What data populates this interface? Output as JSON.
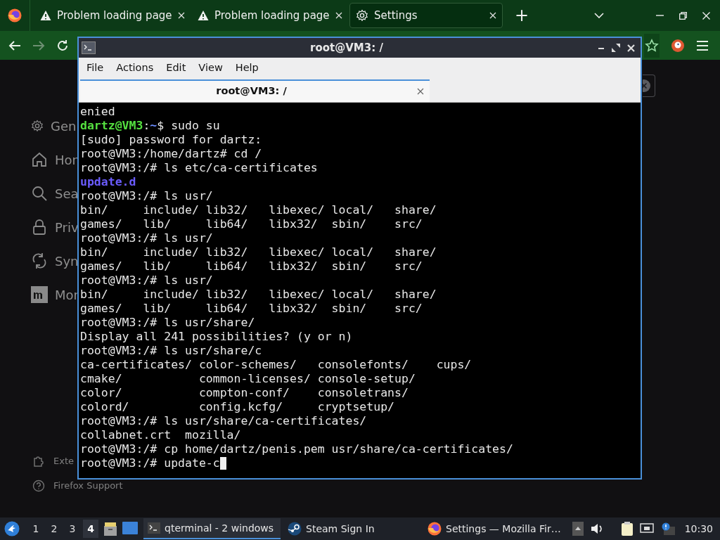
{
  "browser": {
    "tabs": [
      {
        "title": "Problem loading page",
        "kind": "warning",
        "selected": false
      },
      {
        "title": "Problem loading page",
        "kind": "warning",
        "selected": false
      },
      {
        "title": "Settings",
        "kind": "gear",
        "selected": true
      }
    ],
    "new_tab": "+",
    "sidebar": {
      "items": [
        {
          "label": "Gen",
          "kind": "gear"
        },
        {
          "label": "Hon",
          "kind": "home"
        },
        {
          "label": "Sea",
          "kind": "search"
        },
        {
          "label": "Priv",
          "kind": "lock"
        },
        {
          "label": "Syn",
          "kind": "sync"
        },
        {
          "label": "Mor",
          "kind": "m"
        }
      ],
      "footer": [
        {
          "label": "Exte",
          "kind": "puzzle"
        },
        {
          "label": "Firefox Support",
          "kind": "help"
        }
      ]
    }
  },
  "terminal": {
    "title": "root@VM3: /",
    "menu": [
      "File",
      "Actions",
      "Edit",
      "View",
      "Help"
    ],
    "tabs": [
      {
        "title": "root@VM3: /",
        "selected": true
      }
    ],
    "lines": [
      [
        {
          "t": "enied",
          "kind": "plain"
        }
      ],
      [
        {
          "t": "dartz@VM3",
          "kind": "user"
        },
        {
          "t": ":",
          "kind": "plain"
        },
        {
          "t": "~",
          "kind": "path"
        },
        {
          "t": "$ sudo su",
          "kind": "plain"
        }
      ],
      [
        {
          "t": "[sudo] password for dartz:",
          "kind": "plain"
        }
      ],
      [
        {
          "t": "root@VM3:/home/dartz# cd /",
          "kind": "plain"
        }
      ],
      [
        {
          "t": "root@VM3:/# ls etc/ca-certificates",
          "kind": "plain"
        }
      ],
      [
        {
          "t": "update.d",
          "kind": "dir"
        }
      ],
      [
        {
          "t": "root@VM3:/# ls usr/",
          "kind": "plain"
        }
      ],
      [
        {
          "t": "bin/     include/ lib32/   libexec/ local/   share/",
          "kind": "plain"
        }
      ],
      [
        {
          "t": "games/   lib/     lib64/   libx32/  sbin/    src/",
          "kind": "plain"
        }
      ],
      [
        {
          "t": "root@VM3:/# ls usr/",
          "kind": "plain"
        }
      ],
      [
        {
          "t": "bin/     include/ lib32/   libexec/ local/   share/",
          "kind": "plain"
        }
      ],
      [
        {
          "t": "games/   lib/     lib64/   libx32/  sbin/    src/",
          "kind": "plain"
        }
      ],
      [
        {
          "t": "root@VM3:/# ls usr/",
          "kind": "plain"
        }
      ],
      [
        {
          "t": "bin/     include/ lib32/   libexec/ local/   share/",
          "kind": "plain"
        }
      ],
      [
        {
          "t": "games/   lib/     lib64/   libx32/  sbin/    src/",
          "kind": "plain"
        }
      ],
      [
        {
          "t": "root@VM3:/# ls usr/share/",
          "kind": "plain"
        }
      ],
      [
        {
          "t": "Display all 241 possibilities? (y or n)",
          "kind": "plain"
        }
      ],
      [
        {
          "t": "root@VM3:/# ls usr/share/c",
          "kind": "plain"
        }
      ],
      [
        {
          "t": "ca-certificates/ color-schemes/   consolefonts/    cups/",
          "kind": "plain"
        }
      ],
      [
        {
          "t": "cmake/           common-licenses/ console-setup/",
          "kind": "plain"
        }
      ],
      [
        {
          "t": "color/           compton-conf/    consoletrans/",
          "kind": "plain"
        }
      ],
      [
        {
          "t": "colord/          config.kcfg/     cryptsetup/",
          "kind": "plain"
        }
      ],
      [
        {
          "t": "root@VM3:/# ls usr/share/ca-certificates/",
          "kind": "plain"
        }
      ],
      [
        {
          "t": "collabnet.crt  mozilla/",
          "kind": "plain"
        }
      ],
      [
        {
          "t": "root@VM3:/# cp home/dartz/penis.pem usr/share/ca-certificates/",
          "kind": "plain"
        }
      ],
      [
        {
          "t": "root@VM3:/# update-c",
          "kind": "plain"
        }
      ]
    ],
    "cursor": true
  },
  "taskbar": {
    "workspaces": [
      {
        "label": "1",
        "selected": false
      },
      {
        "label": "2",
        "selected": false
      },
      {
        "label": "3",
        "selected": false
      },
      {
        "label": "4",
        "selected": true
      }
    ],
    "tasks": [
      {
        "label": "qterminal - 2 windows",
        "kind": "terminal",
        "selected": true
      },
      {
        "label": "Steam Sign In",
        "kind": "steam",
        "selected": false
      },
      {
        "label": "Settings — Mozilla Fir…",
        "kind": "firefox",
        "selected": false
      }
    ],
    "clock": "10:30"
  }
}
